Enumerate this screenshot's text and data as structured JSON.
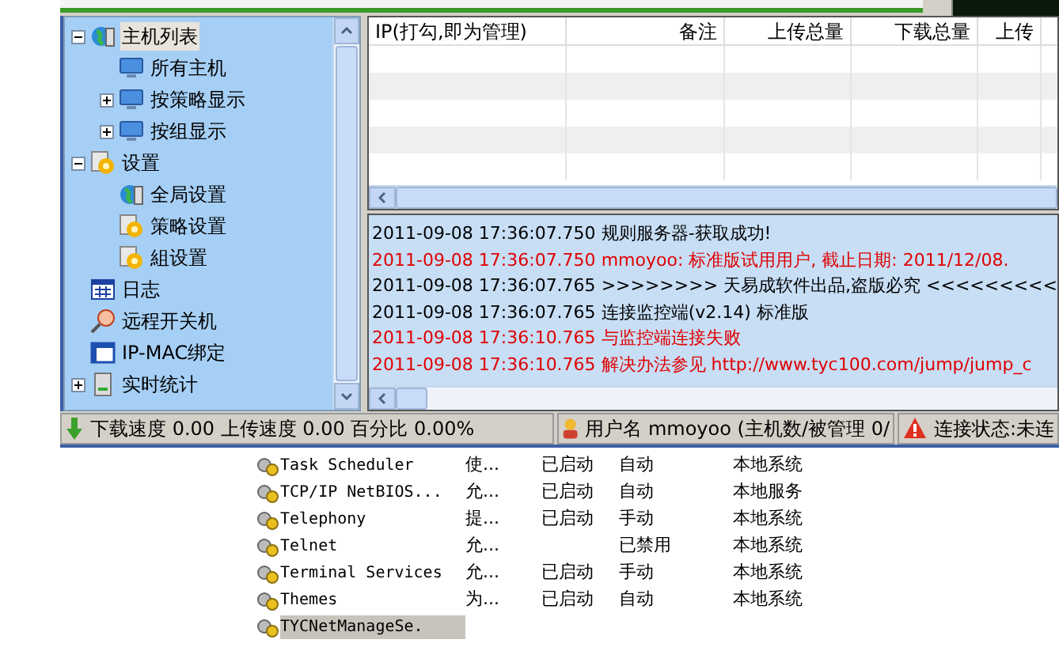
{
  "tree": [
    {
      "label": "主机列表",
      "selected": true,
      "expanded": true,
      "children": [
        {
          "label": "所有主机",
          "selected": false
        },
        {
          "label": "按策略显示",
          "selected": false,
          "expanded": false
        },
        {
          "label": "按组显示",
          "selected": false,
          "expanded": false
        }
      ]
    },
    {
      "label": "设置",
      "selected": false,
      "expanded": true,
      "children": [
        {
          "label": "全局设置",
          "selected": false
        },
        {
          "label": "策略设置",
          "selected": false
        },
        {
          "label": "組设置",
          "selected": false
        }
      ]
    },
    {
      "label": "日志",
      "selected": false
    },
    {
      "label": "远程开关机",
      "selected": false
    },
    {
      "label": "IP-MAC绑定",
      "selected": false
    },
    {
      "label": "实时统计",
      "selected": false,
      "expanded": false
    }
  ],
  "host_table": {
    "columns": [
      "IP(打勾,即为管理)",
      "备注",
      "上传总量",
      "下载总量",
      "上传"
    ]
  },
  "log": [
    {
      "time": "2011-09-08 17:36:07.750",
      "message": "规则服务器-获取成功!",
      "color": "#000000"
    },
    {
      "time": "2011-09-08 17:36:07.750",
      "message": "mmoyoo: 标准版试用用户, 截止日期: 2011/12/08.",
      "color": "#e00000"
    },
    {
      "time": "2011-09-08 17:36:07.765",
      "message": ">>>>>>>>  天易成软件出品,盗版必究  <<<<<<<<<",
      "color": "#000000"
    },
    {
      "time": "2011-09-08 17:36:07.765",
      "message": "连接监控端(v2.14) 标准版",
      "color": "#000000"
    },
    {
      "time": "2011-09-08 17:36:10.765",
      "message": "与监控端连接失败",
      "color": "#e00000"
    },
    {
      "time": "2011-09-08 17:36:10.765",
      "message": "解决办法参见 http://www.tyc100.com/jump/jump_c",
      "color": "#e00000"
    }
  ],
  "status_bar": {
    "speed": "下载速度 0.00 上传速度 0.00 百分比 0.00%",
    "user": "用户名 mmoyoo (主机数/被管理 0/",
    "connection": "连接状态:未连"
  },
  "services": [
    {
      "name": "Task Scheduler",
      "description": "使...",
      "status": "已启动",
      "startup": "自动",
      "logon": "本地系统",
      "selected": false
    },
    {
      "name": "TCP/IP NetBIOS...",
      "description": "允...",
      "status": "已启动",
      "startup": "自动",
      "logon": "本地服务",
      "selected": false
    },
    {
      "name": "Telephony",
      "description": "提...",
      "status": "已启动",
      "startup": "手动",
      "logon": "本地系统",
      "selected": false
    },
    {
      "name": "Telnet",
      "description": "允...",
      "startup": "已禁用",
      "logon": "本地系统",
      "selected": false
    },
    {
      "name": "Terminal Services",
      "description": "允...",
      "status": "已启动",
      "startup": "手动",
      "logon": "本地系统",
      "selected": false
    },
    {
      "name": "Themes",
      "description": "为...",
      "status": "已启动",
      "startup": "自动",
      "logon": "本地系统",
      "selected": false
    },
    {
      "name": "TYCNetManageSe.",
      "selected": true
    }
  ]
}
